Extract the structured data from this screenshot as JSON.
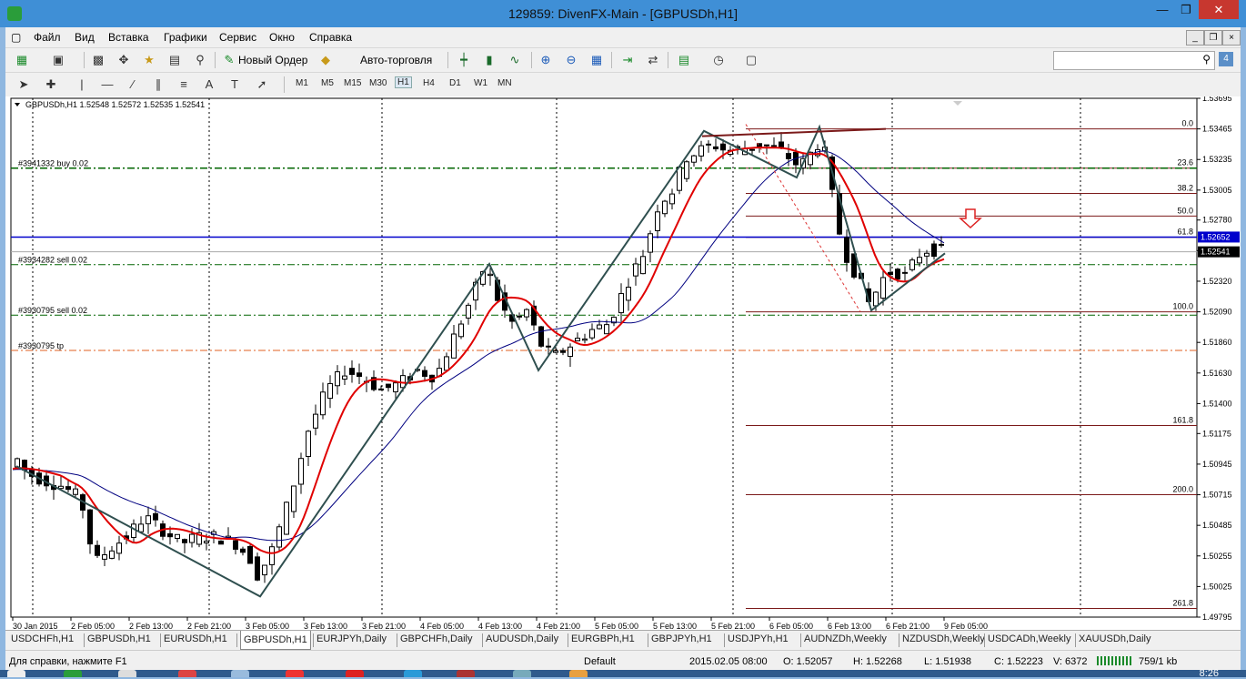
{
  "window": {
    "title": "129859: DivenFX-Main - [GBPUSDh,H1]"
  },
  "menu": {
    "items": [
      "Файл",
      "Вид",
      "Вставка",
      "Графики",
      "Сервис",
      "Окно",
      "Справка"
    ]
  },
  "toolbar": {
    "new_order_label": "Новый Ордер",
    "autotrade_label": "Авто-торговля",
    "notification_count": "4"
  },
  "timeframes": [
    "M1",
    "M5",
    "M15",
    "M30",
    "H1",
    "H4",
    "D1",
    "W1",
    "MN"
  ],
  "active_timeframe": "H1",
  "chart_data": {
    "type": "candlestick",
    "header": "GBPUSDh,H1  1.52548 1.52572 1.52535 1.52541",
    "y_ticks": [
      "1.53695",
      "1.53465",
      "1.53235",
      "1.53005",
      "1.52780",
      "1.52550",
      "1.52320",
      "1.52090",
      "1.51860",
      "1.51630",
      "1.51400",
      "1.51175",
      "1.50945",
      "1.50715",
      "1.50485",
      "1.50255",
      "1.50025",
      "1.49795"
    ],
    "y_range": [
      1.49795,
      1.53695
    ],
    "x_ticks": [
      "30 Jan 2015",
      "2 Feb 05:00",
      "2 Feb 13:00",
      "2 Feb 21:00",
      "3 Feb 05:00",
      "3 Feb 13:00",
      "3 Feb 21:00",
      "4 Feb 05:00",
      "4 Feb 13:00",
      "4 Feb 21:00",
      "5 Feb 05:00",
      "5 Feb 13:00",
      "5 Feb 21:00",
      "6 Feb 05:00",
      "6 Feb 13:00",
      "6 Feb 21:00",
      "9 Feb 05:00"
    ],
    "bid_label": "1.52541",
    "level_label": "1.52652",
    "orders": [
      "#3941332 buy 0.02",
      "#3934282 sell 0.02",
      "#3930795 sell 0.02",
      "#3930795 tp"
    ],
    "fib_levels": [
      {
        "label": "0.0",
        "price": 1.53465
      },
      {
        "label": "23.6",
        "price": 1.5317
      },
      {
        "label": "38.2",
        "price": 1.5298
      },
      {
        "label": "50.0",
        "price": 1.5281
      },
      {
        "label": "61.8",
        "price": 1.5265
      },
      {
        "label": "100.0",
        "price": 1.5209
      },
      {
        "label": "161.8",
        "price": 1.51235
      },
      {
        "label": "200.0",
        "price": 1.50715
      },
      {
        "label": "261.8",
        "price": 1.4986
      }
    ],
    "colors": {
      "buy_line": "#006400",
      "sell_line": "#006400",
      "tp_line": "#e06020",
      "blue_level": "#0000cc",
      "fib": "#7b1a1a",
      "ma_fast": "#e00000",
      "ma_slow": "#000080",
      "zigzag": "#2f4f4f"
    }
  },
  "tabs": [
    "USDCHFh,H1",
    "GBPUSDh,H1",
    "EURUSDh,H1",
    "GBPUSDh,H1",
    "EURJPYh,Daily",
    "GBPCHFh,Daily",
    "AUDUSDh,Daily",
    "EURGBPh,H1",
    "GBPJPYh,H1",
    "USDJPYh,H1",
    "AUDNZDh,Weekly",
    "NZDUSDh,Weekly",
    "USDCADh,Weekly",
    "XAUUSDh,Daily"
  ],
  "active_tab_index": 3,
  "status": {
    "help": "Для справки, нажмите F1",
    "profile": "Default",
    "datetime": "2015.02.05 08:00",
    "open": "O: 1.52057",
    "high": "H: 1.52268",
    "low": "L: 1.51938",
    "close": "C: 1.52223",
    "volume": "V: 6372",
    "traffic": "759/1 kb"
  },
  "clock": "8:26"
}
